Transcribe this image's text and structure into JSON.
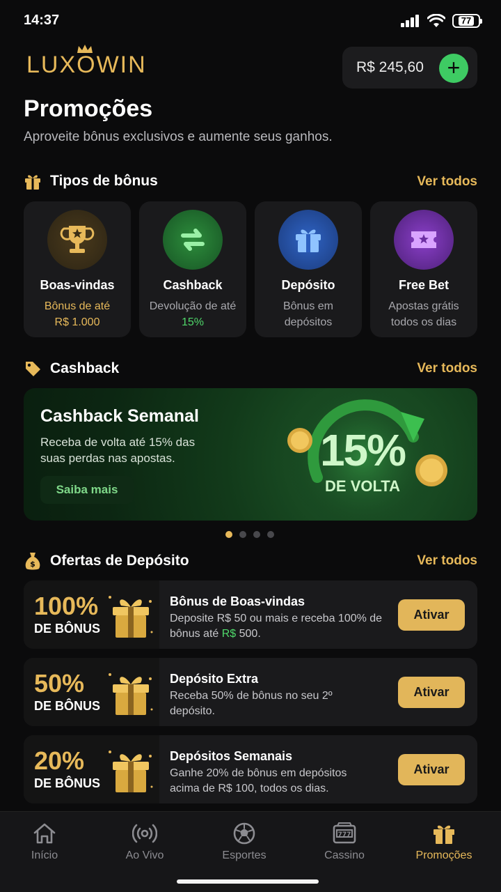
{
  "status": {
    "time": "14:37",
    "battery": "77"
  },
  "header": {
    "logo": "LUXOWIN",
    "balance": "R$ 245,60",
    "add_label": "+"
  },
  "page": {
    "title": "Promoções",
    "subtitle": "Aproveite bônus exclusivos e aumente seus ganhos."
  },
  "bonus_types": {
    "title": "Tipos de bônus",
    "see_all": "Ver todos",
    "items": [
      {
        "name": "Boas-vindas",
        "desc1": "Bônus de até",
        "desc2": "R$ 1.000",
        "icon": "trophy-icon"
      },
      {
        "name": "Cashback",
        "desc1": "Devolução de até",
        "desc2": "15%",
        "icon": "cashback-arrows-icon"
      },
      {
        "name": "Depósito",
        "desc1": "Bônus em",
        "desc2": "depósitos",
        "icon": "gift-icon"
      },
      {
        "name": "Free Bet",
        "desc1": "Apostas grátis",
        "desc2": "todos os dias",
        "icon": "ticket-icon"
      }
    ]
  },
  "cashback": {
    "title": "Cashback",
    "see_all": "Ver todos",
    "banner_title": "Cashback Semanal",
    "banner_desc": "Receba de volta até 15% das suas perdas nas apostas.",
    "button": "Saiba mais",
    "badge_value": "15%",
    "badge_label": "DE VOLTA",
    "carousel_pages": 4,
    "carousel_active": 1
  },
  "deposit_offers": {
    "title": "Ofertas de Depósito",
    "see_all": "Ver todos",
    "items": [
      {
        "pct": "100%",
        "pct_label": "DE BÔNUS",
        "title": "Bônus de Boas-vindas",
        "desc_a": "Deposite R$ 50 ou mais e receba 100% de bônus até ",
        "desc_highlight": "R$",
        "desc_b": " 500.",
        "button": "Ativar"
      },
      {
        "pct": "50%",
        "pct_label": "DE BÔNUS",
        "title": "Depósito Extra",
        "desc": "Receba 50% de bônus no seu 2º depósito.",
        "button": "Ativar"
      },
      {
        "pct": "20%",
        "pct_label": "DE BÔNUS",
        "title": "Depósitos Semanais",
        "desc": "Ganhe 20% de bônus em depósitos acima de R$ 100, todos os dias.",
        "button": "Ativar"
      }
    ]
  },
  "nav": {
    "items": [
      {
        "label": "Início",
        "icon": "home-icon"
      },
      {
        "label": "Ao Vivo",
        "icon": "live-icon"
      },
      {
        "label": "Esportes",
        "icon": "soccer-ball-icon"
      },
      {
        "label": "Cassino",
        "icon": "slot-machine-icon"
      },
      {
        "label": "Promoções",
        "icon": "gift-icon"
      }
    ],
    "active": "Promoções"
  },
  "colors": {
    "accent": "#e7b95a",
    "green": "#3ecb63",
    "background": "#0b0b0c",
    "card": "#1a1a1c"
  }
}
